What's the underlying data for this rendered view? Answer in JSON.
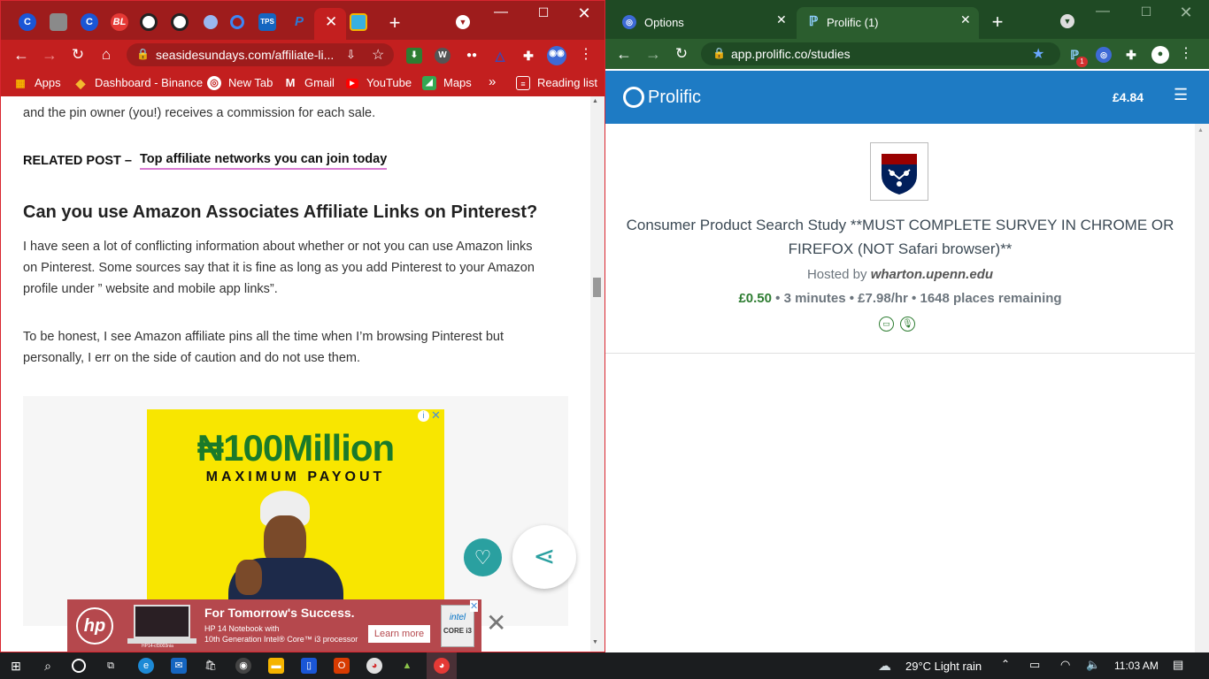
{
  "left_window": {
    "tabs": [
      {
        "icon": "c-logo-icon",
        "label": "C"
      },
      {
        "icon": "image-favicon-icon",
        "label": ""
      },
      {
        "icon": "c-logo-icon",
        "label": "C"
      },
      {
        "icon": "bl-logo-icon",
        "label": "BL"
      },
      {
        "icon": "target-icon",
        "label": ""
      },
      {
        "icon": "target-icon",
        "label": ""
      },
      {
        "icon": "dot-icon",
        "label": ""
      },
      {
        "icon": "ring-icon",
        "label": ""
      },
      {
        "icon": "tps-logo-icon",
        "label": "TPS"
      },
      {
        "icon": "paypal-icon",
        "label": "P"
      },
      {
        "icon": "close-icon",
        "label": "×"
      },
      {
        "icon": "image-favicon-icon",
        "label": ""
      }
    ],
    "new_tab": "+",
    "url": "seasidesundays.com/affiliate-li...",
    "bookmarks": [
      {
        "icon": "apps-icon",
        "label": "Apps"
      },
      {
        "icon": "binance-icon",
        "label": "Dashboard - Binance"
      },
      {
        "icon": "globe-icon",
        "label": "New Tab"
      },
      {
        "icon": "gmail-icon",
        "label": "Gmail"
      },
      {
        "icon": "youtube-icon",
        "label": "YouTube"
      },
      {
        "icon": "maps-icon",
        "label": "Maps"
      }
    ],
    "more_bookmarks": "»",
    "reading_list": "Reading list",
    "article": {
      "p0": "and the pin owner (you!) receives a commission for each sale.",
      "related_prefix": "RELATED POST – ",
      "related_link": "Top affiliate networks you can join today",
      "heading": "Can you use Amazon Associates Affiliate Links on Pinterest?",
      "p1_l1": "I have seen a lot of conflicting information about whether or not you can use Amazon links",
      "p1_l2": "on Pinterest. Some sources say that it is fine as long as you add Pinterest to your Amazon",
      "p1_l3": "profile under ” website and mobile app links”.",
      "p2_l1": "To be honest, I see Amazon affiliate pins all the time when I’m browsing Pinterest but",
      "p2_l2": "personally, I err on the side of caution and do not use them."
    },
    "ad_banner": {
      "headline": "₦100Million",
      "subline": "MAXIMUM PAYOUT"
    },
    "hp_ad": {
      "logo": "hp",
      "title": "For Tomorrow's Success.",
      "line1": "HP 14 Notebook with",
      "line2": "10th Generation Intel® Core™ i3 processor",
      "cta": "Learn more",
      "badge_top": "intel",
      "badge_bottom": "CORE i3",
      "laptop_label": "HP14-cf3003nia"
    }
  },
  "right_window": {
    "tabs": [
      {
        "icon": "globe-icon",
        "label": "Options"
      },
      {
        "icon": "prolific-icon",
        "label": "Prolific (1)"
      }
    ],
    "new_tab": "+",
    "url": "app.prolific.co/studies",
    "ext_badge": "1",
    "header": {
      "brand": "Prolific",
      "balance": "£4.84"
    },
    "study": {
      "title_l1": "Consumer Product Search Study **MUST COMPLETE SURVEY IN CHROME OR",
      "title_l2": "FIREFOX (NOT Safari browser)**",
      "hosted_prefix": "Hosted by ",
      "host": "wharton.upenn.edu",
      "reward": "£0.50",
      "details": "• 3 minutes • £7.98/hr • 1648 places remaining"
    }
  },
  "taskbar": {
    "weather": "29°C  Light rain",
    "time": "11:03 AM"
  },
  "colors": {
    "left_tabbar": "#9e1c1c",
    "left_toolbar": "#c31f1f",
    "right_tabbar": "#1f4a24",
    "right_toolbar": "#2b5d2e",
    "prolific_blue": "#1e7bc4",
    "reward_green": "#2e7d32",
    "ad_yellow": "#f8e600",
    "ad_green": "#1a7a2a"
  }
}
